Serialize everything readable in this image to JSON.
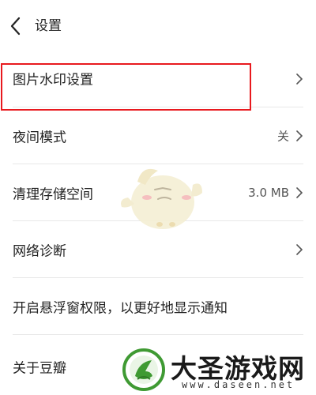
{
  "header": {
    "title": "设置",
    "back_icon": "chevron-left-icon"
  },
  "rows": [
    {
      "label": "图片水印设置",
      "value": "",
      "icon": "chevron-right-icon",
      "highlighted": true
    },
    {
      "label": "夜间模式",
      "value": "关",
      "icon": "chevron-right-icon"
    },
    {
      "label": "清理存储空间",
      "value": "3.0 MB",
      "icon": "chevron-right-icon"
    },
    {
      "label": "网络诊断",
      "value": "",
      "icon": "chevron-right-icon"
    },
    {
      "label": "开启悬浮窗权限，以更好地显示通知",
      "value": ""
    },
    {
      "label": "关于豆瓣",
      "value": ""
    }
  ],
  "colors": {
    "highlight_border": "#e8191e",
    "divider": "#e8e8e8",
    "watermark_green": "#3f9a33"
  },
  "watermark": {
    "text": "大圣游戏网",
    "url": "www.daseen.net"
  }
}
